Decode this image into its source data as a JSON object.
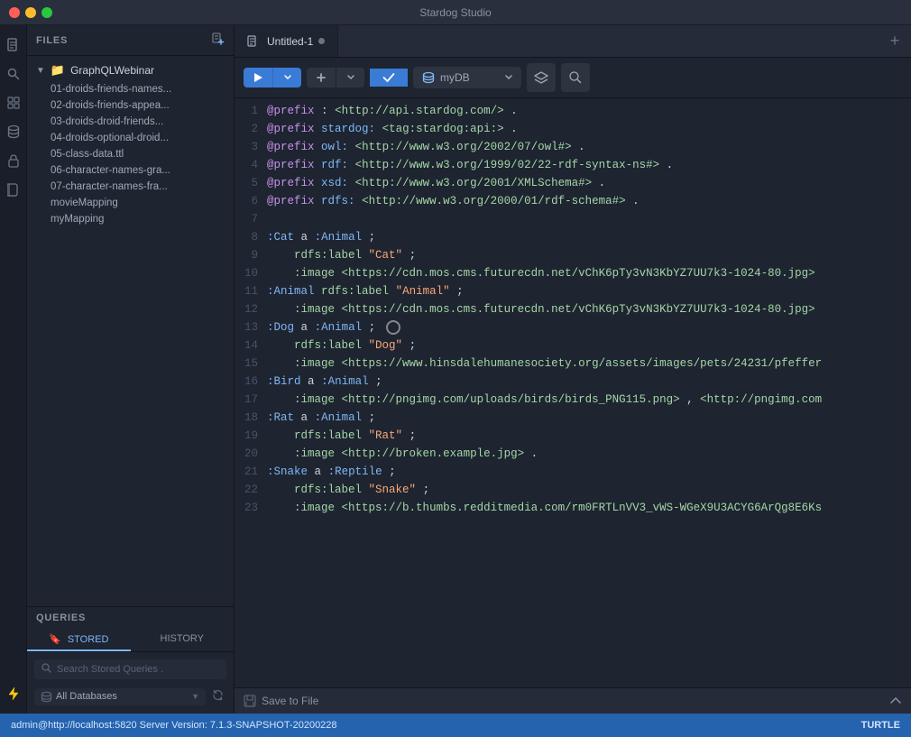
{
  "app": {
    "title": "Stardog Studio"
  },
  "title_bar_buttons": {
    "close": "close",
    "minimize": "minimize",
    "maximize": "maximize"
  },
  "icon_sidebar": {
    "items": [
      {
        "name": "document-icon",
        "symbol": "📄"
      },
      {
        "name": "search-icon",
        "symbol": "🔍"
      },
      {
        "name": "grid-icon",
        "symbol": "⊞"
      },
      {
        "name": "database-icon",
        "symbol": "🗄"
      },
      {
        "name": "lock-icon",
        "symbol": "🔒"
      },
      {
        "name": "book-icon",
        "symbol": "📖"
      }
    ],
    "bottom": [
      {
        "name": "lightning-icon",
        "symbol": "⚡"
      }
    ]
  },
  "file_panel": {
    "title": "FILES",
    "folder": "GraphQLWebinar",
    "items": [
      "01-droids-friends-names...",
      "02-droids-friends-appea...",
      "03-droids-droid-friends...",
      "04-droids-optional-droid...",
      "05-class-data.ttl",
      "06-character-names-gra...",
      "07-character-names-fra...",
      "movieMapping",
      "myMapping"
    ]
  },
  "queries_section": {
    "title": "QUERIES",
    "tabs": [
      {
        "label": "STORED",
        "active": true
      },
      {
        "label": "HISTORY",
        "active": false
      }
    ],
    "search_placeholder": "Search Stored Queries .",
    "db_filter_label": "All Databases"
  },
  "editor": {
    "tab_name": "Untitled-1",
    "toolbar": {
      "run_label": "▶",
      "add_label": "+",
      "check_label": "✓",
      "db_name": "myDB",
      "layers_label": "⊞",
      "search_label": "🔍"
    },
    "lines": [
      {
        "num": 1,
        "text": "@prefix : <http://api.stardog.com/> ."
      },
      {
        "num": 2,
        "text": "@prefix stardog: <tag:stardog:api:> ."
      },
      {
        "num": 3,
        "text": "@prefix owl: <http://www.w3.org/2002/07/owl#> ."
      },
      {
        "num": 4,
        "text": "@prefix rdf: <http://www.w3.org/1999/02/22-rdf-syntax-ns#> ."
      },
      {
        "num": 5,
        "text": "@prefix xsd: <http://www.w3.org/2001/XMLSchema#> ."
      },
      {
        "num": 6,
        "text": "@prefix rdfs: <http://www.w3.org/2000/01/rdf-schema#> ."
      },
      {
        "num": 7,
        "text": ""
      },
      {
        "num": 8,
        "text": ":Cat a :Animal ;"
      },
      {
        "num": 9,
        "text": "    rdfs:label \"Cat\" ;"
      },
      {
        "num": 10,
        "text": "    :image <https://cdn.mos.cms.futurecdn.net/vChK6pTy3vN3KbYZ7UU7k3-1024-80.jpg>"
      },
      {
        "num": 11,
        "text": ":Animal rdfs:label \"Animal\" ;"
      },
      {
        "num": 12,
        "text": "    :image <https://cdn.mos.cms.futurecdn.net/vChK6pTy3vN3KbYZ7UU7k3-1024-80.jpg>"
      },
      {
        "num": 13,
        "text": ":Dog a :Animal ;"
      },
      {
        "num": 14,
        "text": "    rdfs:label \"Dog\" ;"
      },
      {
        "num": 15,
        "text": "    :image <https://www.hinsdalehumanesociety.org/assets/images/pets/24231/pfeffer"
      },
      {
        "num": 16,
        "text": ":Bird a :Animal ;"
      },
      {
        "num": 17,
        "text": "    :image <http://pngimg.com/uploads/birds/birds_PNG115.png> , <http://pngimg.com"
      },
      {
        "num": 18,
        "text": ":Rat a :Animal ;"
      },
      {
        "num": 19,
        "text": "    rdfs:label \"Rat\" ;"
      },
      {
        "num": 20,
        "text": "    :image <http://broken.example.jpg> ."
      },
      {
        "num": 21,
        "text": ":Snake a :Reptile ;"
      },
      {
        "num": 22,
        "text": "    rdfs:label \"Snake\" ;"
      },
      {
        "num": 23,
        "text": "    :image <https://b.thumbs.redditmedia.com/rm0FRTLnVV3_vWS-WGeX9U3ACYG6ArQg8E6Ks"
      }
    ]
  },
  "save_bar": {
    "label": "Save to File"
  },
  "status_bar": {
    "left": "admin@http://localhost:5820    Server Version: 7.1.3-SNAPSHOT-20200228",
    "right": "TURTLE"
  }
}
